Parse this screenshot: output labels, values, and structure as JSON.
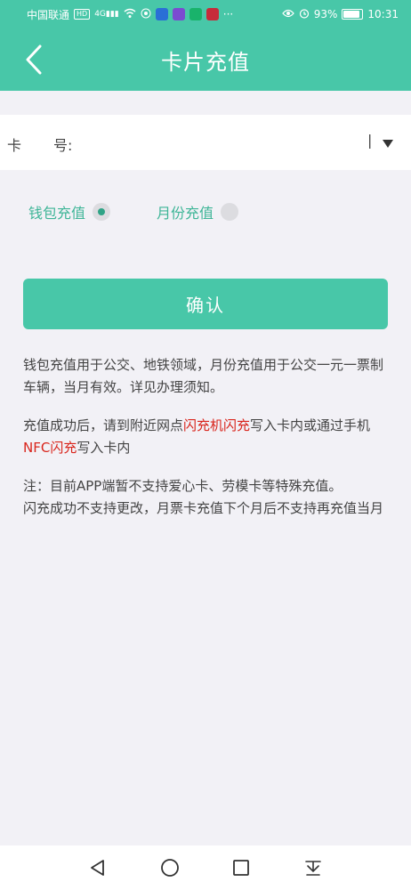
{
  "status_bar": {
    "carrier": "中国联通",
    "hd": "HD",
    "signal_tag": "4G",
    "more": "···",
    "battery": "93%",
    "time": "10:31"
  },
  "header": {
    "title": "卡片充值"
  },
  "card": {
    "label_part1": "卡",
    "label_part2": "号:",
    "value": "",
    "cursor_mark": "|"
  },
  "recharge_type": {
    "options": [
      {
        "label": "钱包充值",
        "selected": true
      },
      {
        "label": "月份充值",
        "selected": false
      }
    ]
  },
  "confirm": {
    "label": "确认"
  },
  "notes": {
    "p1": "钱包充值用于公交、地铁领域，月份充值用于公交一元一票制车辆，当月有效。详见办理须知。",
    "p2_a": "充值成功后，请到附近网点",
    "p2_red1": "闪充机闪充",
    "p2_b": "写入卡内或通过手机",
    "p2_red2": "NFC闪充",
    "p2_c": "写入卡内",
    "p3_line1": "注：目前APP端暂不支持爱心卡、劳模卡等特殊充值。",
    "p3_line2": "闪充成功不支持更改，月票卡充值下个月后不支持再充值当月"
  },
  "colors": {
    "primary": "#48c7a8",
    "accent_text": "#3eb597",
    "highlight": "#d9251c"
  }
}
